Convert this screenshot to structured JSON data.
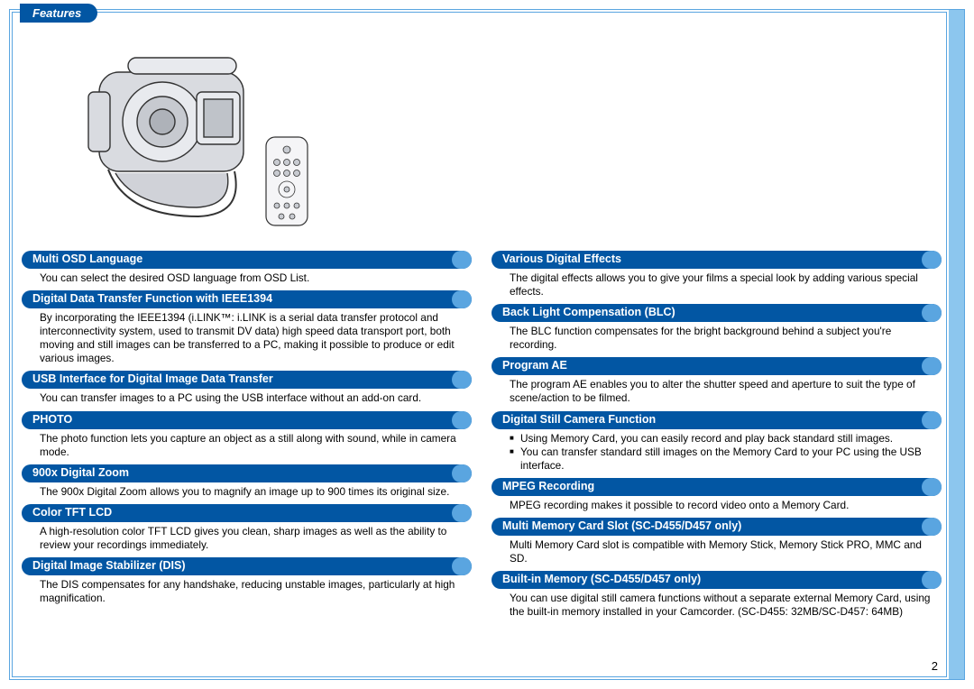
{
  "page": {
    "tab_title": "Features",
    "page_number": "2"
  },
  "columns": {
    "left": [
      {
        "title": "Multi OSD Language",
        "body": "You can select the desired OSD language from OSD List."
      },
      {
        "title": "Digital Data Transfer Function with IEEE1394",
        "body": "By incorporating the IEEE1394 (i.LINK™: i.LINK is a serial data transfer protocol and interconnectivity system, used to transmit DV data) high speed data transport port, both moving and still images can be transferred to a PC, making it possible to produce or edit various images."
      },
      {
        "title": "USB Interface for Digital Image Data Transfer",
        "body": "You can transfer images to a PC using the USB interface without an add-on card."
      },
      {
        "title": "PHOTO",
        "body": "The photo function lets you capture an object as a still along with sound, while in camera mode."
      },
      {
        "title": "900x Digital Zoom",
        "body": "The 900x Digital Zoom allows you to magnify an image up to 900 times its original size."
      },
      {
        "title": "Color TFT LCD",
        "body": "A high-resolution color TFT LCD gives you clean, sharp images as well as the ability to review your recordings immediately."
      },
      {
        "title": "Digital Image Stabilizer (DIS)",
        "body": "The DIS compensates for any handshake, reducing unstable images, particularly at high magnification."
      }
    ],
    "right": [
      {
        "title": "Various Digital Effects",
        "body": "The digital effects allows you to give your films a special look by adding various special effects."
      },
      {
        "title": "Back Light Compensation (BLC)",
        "body": "The BLC function compensates for the bright background behind a subject you're recording."
      },
      {
        "title": "Program AE",
        "body": "The program AE enables you to alter the shutter speed and aperture to suit the type of scene/action to be filmed."
      },
      {
        "title": "Digital Still Camera Function",
        "list": [
          "Using Memory Card, you can easily record and play back standard still images.",
          "You can transfer standard still images on the Memory Card to your PC using the USB interface."
        ]
      },
      {
        "title": "MPEG Recording",
        "body": "MPEG recording makes it possible to record video onto a Memory Card."
      },
      {
        "title": "Multi Memory Card Slot (SC-D455/D457 only)",
        "body": "Multi Memory Card slot is compatible with Memory Stick, Memory Stick PRO, MMC and SD."
      },
      {
        "title": "Built-in Memory (SC-D455/D457 only)",
        "body": "You can use digital still camera functions without a separate external Memory Card, using the built-in memory installed in your Camcorder. (SC-D455: 32MB/SC-D457: 64MB)"
      }
    ]
  }
}
